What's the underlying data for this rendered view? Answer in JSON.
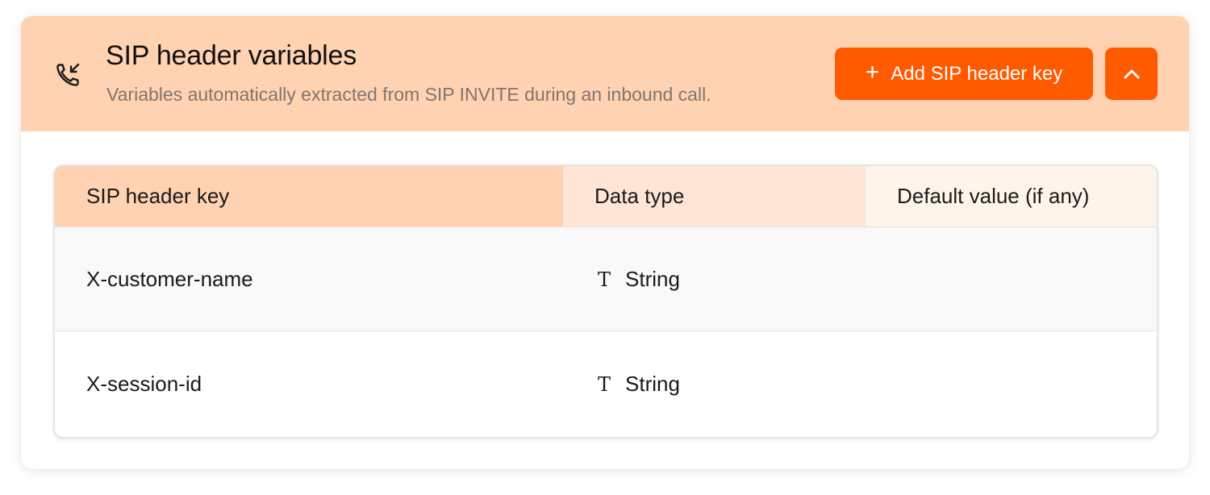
{
  "header": {
    "icon": "phone-incoming-icon",
    "title": "SIP header variables",
    "subtitle": "Variables automatically extracted from SIP INVITE during an inbound call.",
    "add_button_label": "Add SIP header key",
    "add_button_icon": "plus-icon",
    "collapse_button_icon": "chevron-up-icon"
  },
  "table": {
    "columns": [
      "SIP header key",
      "Data type",
      "Default value (if any)"
    ],
    "rows": [
      {
        "key": "X-customer-name",
        "type_icon": "T",
        "type": "String",
        "default": ""
      },
      {
        "key": "X-session-id",
        "type_icon": "T",
        "type": "String",
        "default": ""
      }
    ]
  },
  "colors": {
    "accent": "#ff5a00",
    "header_bg": "#ffd2b2",
    "col_key_bg": "#ffd2b2",
    "col_type_bg": "#ffe5d5",
    "col_default_bg": "#fff4ea"
  }
}
